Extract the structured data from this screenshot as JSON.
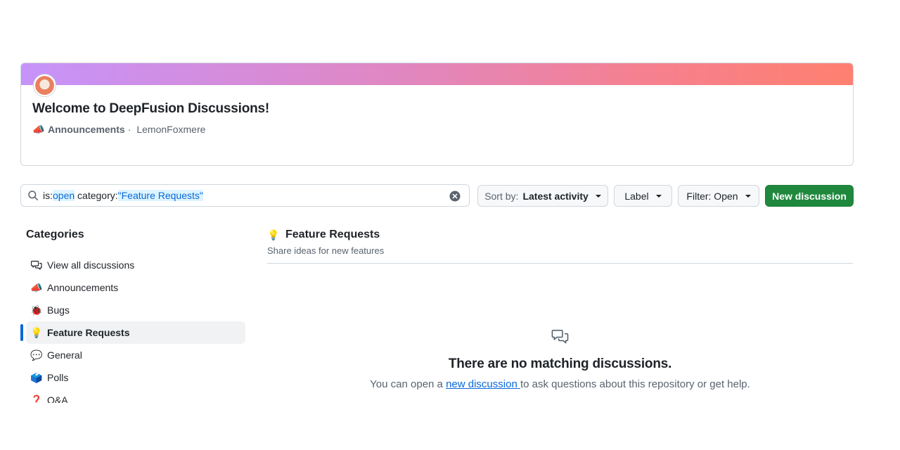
{
  "announcement": {
    "title": "Welcome to DeepFusion Discussions!",
    "category_emoji": "📣",
    "category": "Announcements",
    "separator": "·",
    "author": "LemonFoxmere",
    "banner_colors": [
      "#c693fa",
      "#ff8070"
    ]
  },
  "search": {
    "prefix": "is:",
    "open_token": "open",
    "middle": " category:",
    "category_token": "\"Feature Requests\""
  },
  "toolbar": {
    "sort_prefix": "Sort by:",
    "sort_value": "Latest activity",
    "label": "Label",
    "filter": "Filter: Open",
    "new_discussion": "New discussion",
    "accent": "#1f883d"
  },
  "sidebar": {
    "heading": "Categories",
    "items": [
      {
        "icon": "discussion-icon",
        "emoji": "",
        "label": "View all discussions"
      },
      {
        "icon": "megaphone-icon",
        "emoji": "📣",
        "label": "Announcements"
      },
      {
        "icon": "ladybug-icon",
        "emoji": "🐞",
        "label": "Bugs"
      },
      {
        "icon": "lightbulb-icon",
        "emoji": "💡",
        "label": "Feature Requests",
        "active": true
      },
      {
        "icon": "speech-balloon-icon",
        "emoji": "💬",
        "label": "General"
      },
      {
        "icon": "ballot-box-icon",
        "emoji": "🗳️",
        "label": "Polls"
      },
      {
        "icon": "question-icon",
        "emoji": "❓",
        "label": "Q&A"
      }
    ]
  },
  "main": {
    "emoji": "💡",
    "title": "Feature Requests",
    "description": "Share ideas for new features",
    "empty_title": "There are no matching discussions.",
    "empty_text_before": "You can open a ",
    "empty_link": "new discussion ",
    "empty_text_after": "to ask questions about this repository or get help."
  }
}
